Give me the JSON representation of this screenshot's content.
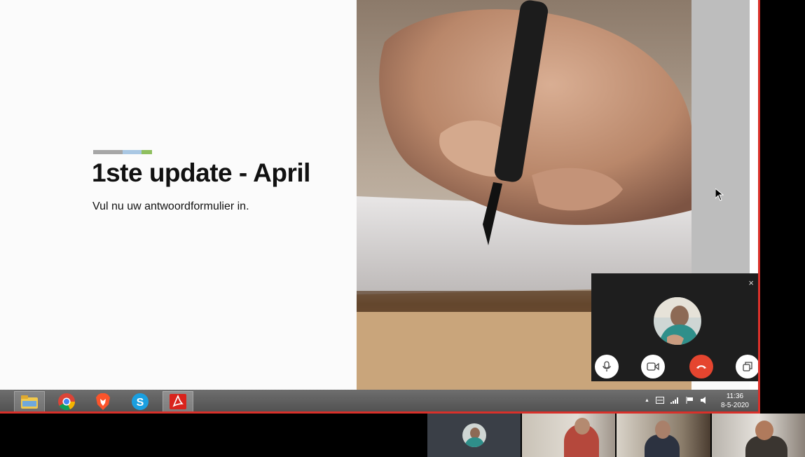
{
  "slide": {
    "title": "1ste update - April",
    "subtitle": "Vul nu uw antwoordformulier in.",
    "accent_colors": [
      "#a6a6a6",
      "#a9c7e3",
      "#8fbf5f"
    ]
  },
  "call_window": {
    "close_label": "×",
    "buttons": [
      "microphone-icon",
      "video-camera-icon",
      "hang-up-icon",
      "pop-out-icon"
    ],
    "end_call_color": "#e5452f"
  },
  "taskbar": {
    "apps": [
      "file-explorer-icon",
      "chrome-icon",
      "brave-icon",
      "skype-icon",
      "acrobat-icon"
    ],
    "clock_time": "11:36",
    "clock_date": "8-5-2020",
    "tray_arrow": "▲"
  },
  "colors": {
    "window_border": "#d9302a",
    "taskbar": "#5a5a5a"
  }
}
